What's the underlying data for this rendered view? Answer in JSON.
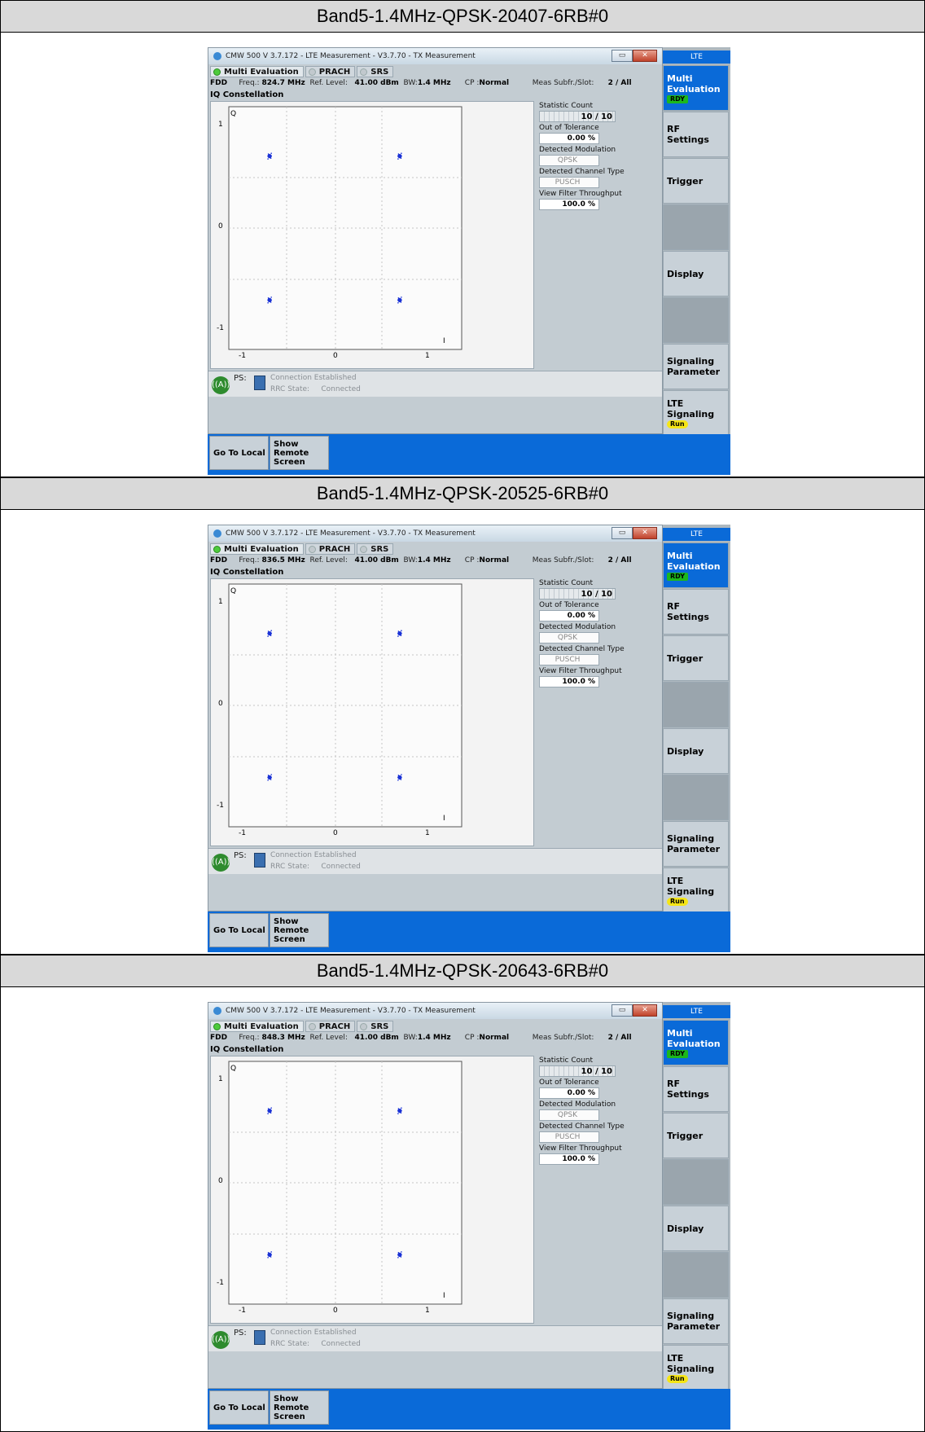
{
  "app": {
    "window_title": "CMW 500 V 3.7.172 - LTE Measurement  - V3.7.70 - TX Measurement",
    "window_buttons": [
      "▭",
      "✕"
    ],
    "tabs": [
      "Multi Evaluation",
      "PRACH",
      "SRS"
    ],
    "iq_title": "IQ Constellation",
    "info_fixed": {
      "mode": "FDD",
      "freq_label": "Freq.:",
      "ref_label": "Ref. Level:",
      "ref_value": "41.00 dBm",
      "bw_label": "BW:",
      "bw_value": "1.4 MHz",
      "cp_label": "CP :",
      "cp_value": "Normal",
      "meas_label": "Meas Subfr./Slot:",
      "meas_value": "2  / All"
    },
    "plot_labels": {
      "q": "Q",
      "i": "I",
      "y_ticks": [
        "1",
        "0",
        "-1"
      ],
      "x_ticks": [
        "-1",
        "0",
        "1"
      ]
    },
    "stats_labels": {
      "statistic_count": "Statistic Count",
      "out_of_tolerance": "Out of Tolerance",
      "detected_modulation": "Detected Modulation",
      "detected_channel_type": "Detected Channel Type",
      "view_filter_throughput": "View Filter Throughput"
    },
    "stats_values": {
      "statistic_count": "10 / 10",
      "out_of_tolerance": "0.00  %",
      "detected_modulation": "QPSK",
      "detected_channel_type": "PUSCH",
      "view_filter_throughput": "100.0  %"
    },
    "status": {
      "ps": "PS:",
      "conn": "Connection Established",
      "rrc_label": "RRC State:",
      "rrc_value": "Connected"
    },
    "bottom_buttons": {
      "go_local": "Go To Local",
      "show_remote_1": "Show Remote",
      "show_remote_2": "Screen"
    },
    "side": {
      "header": "LTE",
      "multi_eval_1": "Multi",
      "multi_eval_2": "Evaluation",
      "rdy": "RDY",
      "rf_1": "RF",
      "rf_2": "Settings",
      "trigger": "Trigger",
      "display": "Display",
      "sig_param_1": "Signaling",
      "sig_param_2": "Parameter",
      "lte_sig_1": "LTE",
      "lte_sig_2": "Signaling",
      "run": "Run"
    }
  },
  "sections": [
    {
      "title": "Band5-1.4MHz-QPSK-20407-6RB#0",
      "freq": "824.7 MHz"
    },
    {
      "title": "Band5-1.4MHz-QPSK-20525-6RB#0",
      "freq": "836.5 MHz"
    },
    {
      "title": "Band5-1.4MHz-QPSK-20643-6RB#0",
      "freq": "848.3 MHz"
    }
  ],
  "constellation_points": [
    {
      "i": -0.707,
      "q": 0.707
    },
    {
      "i": 0.707,
      "q": 0.707
    },
    {
      "i": -0.707,
      "q": -0.707
    },
    {
      "i": 0.707,
      "q": -0.707
    }
  ],
  "colors": {
    "accent_blue": "#0a6ad8",
    "ready_green": "#1cb81c",
    "run_yellow": "#f5e516",
    "points": "#1a32d6"
  }
}
